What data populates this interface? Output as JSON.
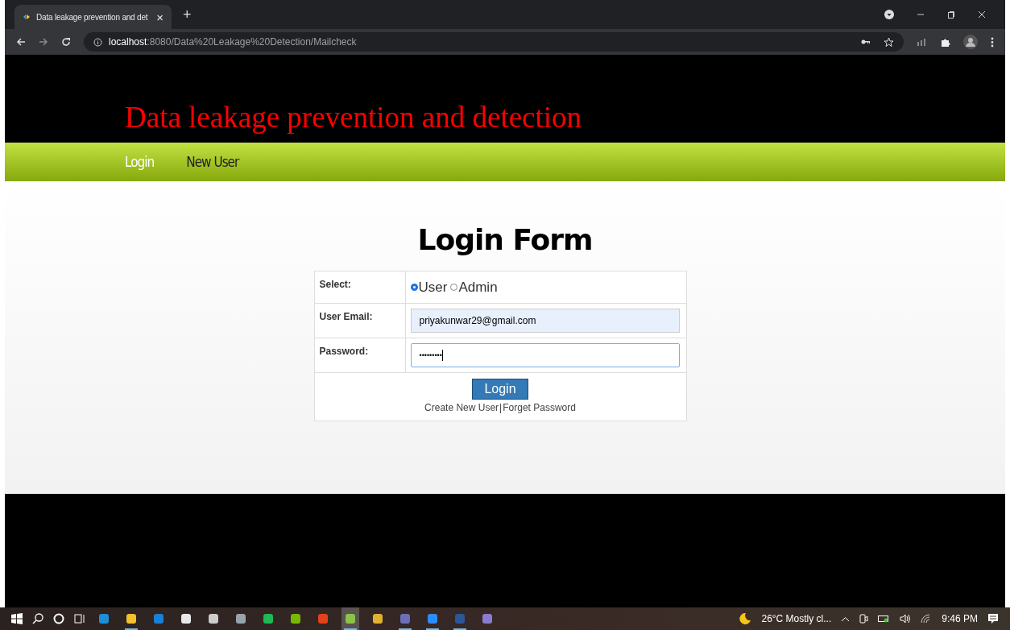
{
  "browser": {
    "tab": {
      "title": "Data leakage prevention and det",
      "close": "×"
    },
    "new_tab": "+",
    "url": {
      "host": "localhost",
      "path": ":8080/Data%20Leakage%20Detection/Mailcheck"
    }
  },
  "site": {
    "title": "Data leakage prevention and detection",
    "nav": [
      {
        "label": "Login",
        "selected": true
      },
      {
        "label": "New User",
        "selected": false
      }
    ]
  },
  "form": {
    "heading": "Login Form",
    "select_label": "Select:",
    "roles": [
      {
        "label": "User",
        "selected": true
      },
      {
        "label": "Admin",
        "selected": false
      }
    ],
    "email_label": "User Email:",
    "email_value": "priyakunwar29@gmail.com",
    "password_label": "Password:",
    "password_value": "•••••••••",
    "submit": "Login",
    "create_link": "Create New User",
    "separator": "|",
    "forget_link": "Forget Password"
  },
  "taskbar": {
    "apps": [
      {
        "running": false,
        "selected": false
      },
      {
        "running": true,
        "selected": false
      },
      {
        "running": false,
        "selected": false
      },
      {
        "running": false,
        "selected": false
      },
      {
        "running": false,
        "selected": false
      },
      {
        "running": false,
        "selected": false
      },
      {
        "running": false,
        "selected": false
      },
      {
        "running": false,
        "selected": false
      },
      {
        "running": false,
        "selected": false
      },
      {
        "running": true,
        "selected": true
      },
      {
        "running": false,
        "selected": false
      },
      {
        "running": true,
        "selected": false
      },
      {
        "running": true,
        "selected": false
      },
      {
        "running": true,
        "selected": false
      },
      {
        "running": false,
        "selected": false
      }
    ],
    "weather": "26°C  Mostly cl...",
    "time": "9:46 PM"
  }
}
